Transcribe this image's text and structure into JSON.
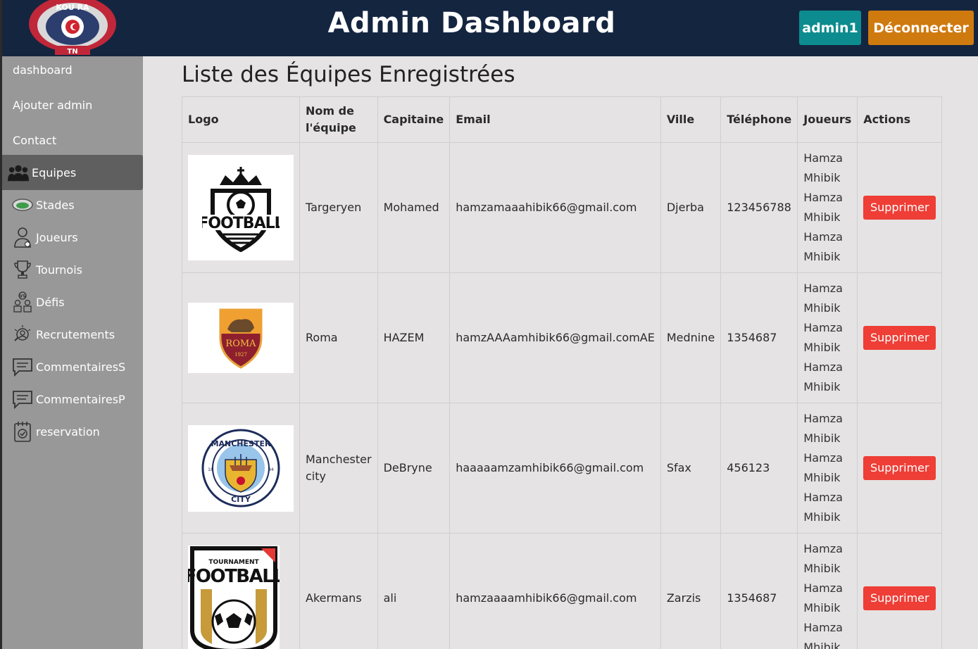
{
  "header": {
    "title": "Admin Dashboard",
    "user_button": "admin1",
    "logout_button": "Déconnecter",
    "logo_text_top": "KOU RA",
    "logo_text_bottom": "TN"
  },
  "sidebar": {
    "items": [
      {
        "label": "dashboard",
        "icon": "none"
      },
      {
        "label": "Ajouter admin",
        "icon": "none"
      },
      {
        "label": "Contact",
        "icon": "none"
      },
      {
        "label": "Equipes",
        "icon": "users-group-icon",
        "active": true
      },
      {
        "label": "Stades",
        "icon": "stadium-icon"
      },
      {
        "label": "Joueurs",
        "icon": "player-icon"
      },
      {
        "label": "Tournois",
        "icon": "trophy-icon"
      },
      {
        "label": "Défis",
        "icon": "versus-icon"
      },
      {
        "label": "Recrutements",
        "icon": "recruitment-icon"
      },
      {
        "label": "CommentairesS",
        "icon": "comment-icon"
      },
      {
        "label": "CommentairesP",
        "icon": "comment-icon"
      },
      {
        "label": "reservation",
        "icon": "calendar-check-icon"
      }
    ]
  },
  "main": {
    "title": "Liste des Équipes Enregistrées",
    "columns": [
      "Logo",
      "Nom de l'équipe",
      "Capitaine",
      "Email",
      "Ville",
      "Téléphone",
      "Joueurs",
      "Actions"
    ],
    "rows": [
      {
        "logo": "football-crest-logo",
        "name": "Targeryen",
        "captain": "Mohamed",
        "email": "hamzamaaahibik66@gmail.com",
        "city": "Djerba",
        "phone": "123456788",
        "players": [
          "Hamza Mhibik",
          "Hamza Mhibik",
          "Hamza Mhibik"
        ],
        "action": "Supprimer"
      },
      {
        "logo": "roma-logo",
        "logo_text": "ROMA",
        "logo_year": "1927",
        "name": "Roma",
        "captain": "HAZEM",
        "email": "hamzAAAamhibik66@gmail.comAE",
        "city": "Mednine",
        "phone": "1354687",
        "players": [
          "Hamza Mhibik",
          "Hamza Mhibik",
          "Hamza Mhibik"
        ],
        "action": "Supprimer"
      },
      {
        "logo": "manchester-city-logo",
        "logo_text_top": "MANCHESTER",
        "logo_text_bottom": "CITY",
        "logo_left": "18",
        "logo_right": "94",
        "name": "Manchester city",
        "captain": "DeBryne",
        "email": "haaaaamzamhibik66@gmail.com",
        "city": "Sfax",
        "phone": "456123",
        "players": [
          "Hamza Mhibik",
          "Hamza Mhibik",
          "Hamza Mhibik"
        ],
        "action": "Supprimer"
      },
      {
        "logo": "tournament-football-logo",
        "logo_text_top": "TOURNAMENT",
        "logo_text_main": "FOOTBALL",
        "name": "Akermans",
        "captain": "ali",
        "email": "hamzaaaamhibik66@gmail.com",
        "city": "Zarzis",
        "phone": "1354687",
        "players": [
          "Hamza Mhibik",
          "Hamza Mhibik",
          "Hamza Mhibik"
        ],
        "action": "Supprimer"
      }
    ]
  },
  "colors": {
    "header_bg": "#142540",
    "sidebar_bg": "#999898",
    "sidebar_active": "#5f5f5f",
    "admin_btn": "#0d8c8f",
    "logout_btn": "#cf7a0f",
    "delete_btn": "#ee3e36"
  }
}
